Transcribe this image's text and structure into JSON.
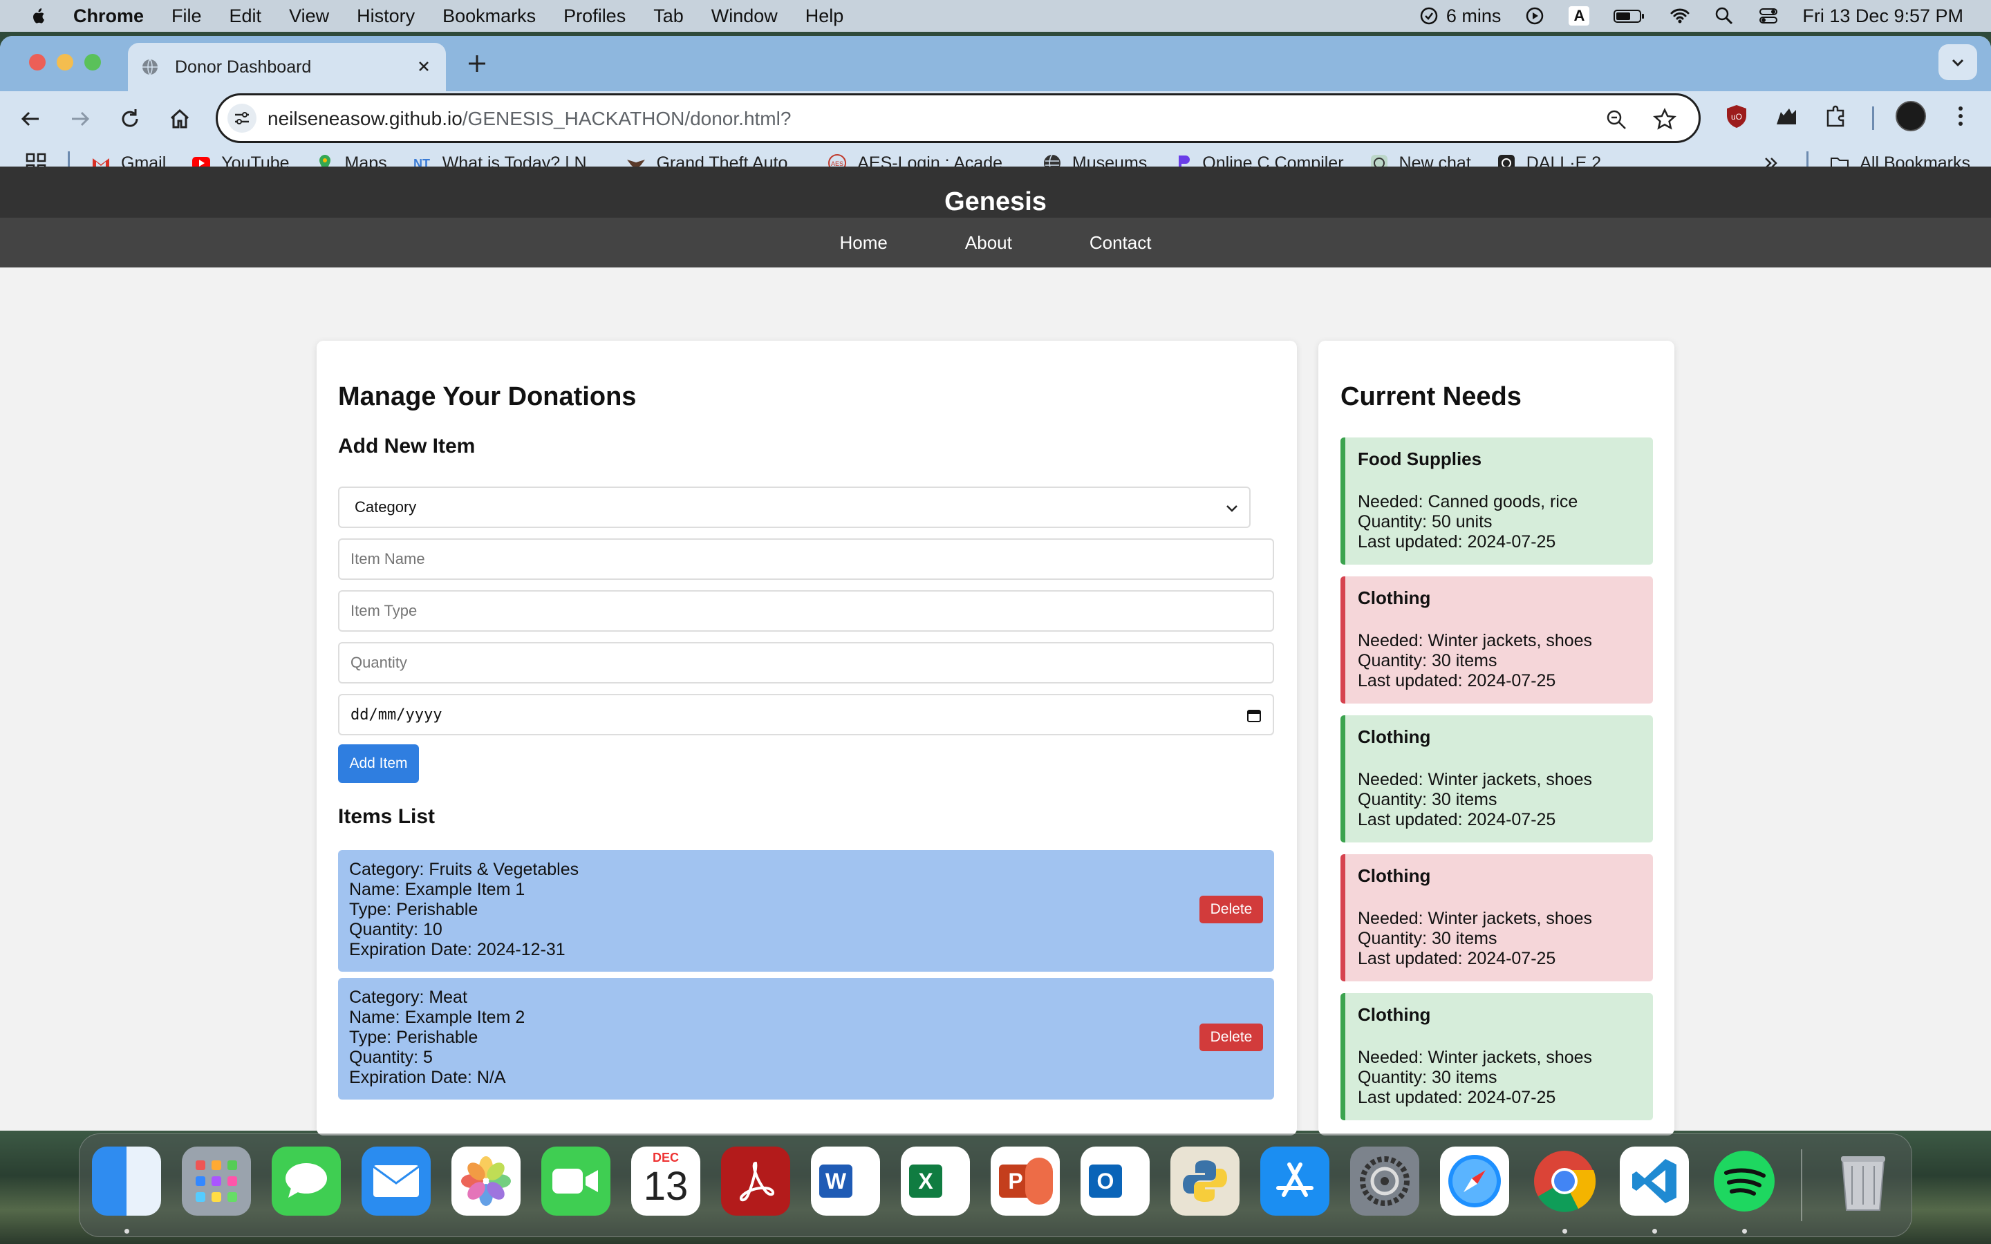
{
  "menubar": {
    "app": "Chrome",
    "menus": [
      "File",
      "Edit",
      "View",
      "History",
      "Bookmarks",
      "Profiles",
      "Tab",
      "Window",
      "Help"
    ],
    "timer": "6 mins",
    "input_indicator": "A",
    "datetime": "Fri 13 Dec  9:57 PM"
  },
  "browser": {
    "tab_title": "Donor Dashboard",
    "url_host": "neilseneasow.github.io",
    "url_path": "/GENESIS_HACKATHON/donor.html?",
    "bookmarks": [
      "Gmail",
      "YouTube",
      "Maps",
      "What is Today? | N...",
      "Grand Theft Auto...",
      "AES-Login : Acade...",
      "Museums",
      "Online C Compiler",
      "New chat",
      "DALL·E 2"
    ],
    "all_bookmarks": "All Bookmarks"
  },
  "site": {
    "title": "Genesis",
    "nav": [
      "Home",
      "About",
      "Contact"
    ]
  },
  "donations": {
    "heading": "Manage Your Donations",
    "add_heading": "Add New Item",
    "category_select": "Category",
    "item_name_placeholder": "Item Name",
    "item_type_placeholder": "Item Type",
    "quantity_placeholder": "Quantity",
    "date_placeholder": "dd/mm/yyyy",
    "add_button": "Add Item",
    "list_heading": "Items List",
    "items": [
      {
        "category": "Category: Fruits & Vegetables",
        "name": "Name: Example Item 1",
        "type": "Type: Perishable",
        "quantity": "Quantity: 10",
        "expiration": "Expiration Date: 2024-12-31",
        "delete": "Delete"
      },
      {
        "category": "Category: Meat",
        "name": "Name: Example Item 2",
        "type": "Type: Perishable",
        "quantity": "Quantity: 5",
        "expiration": "Expiration Date: N/A",
        "delete": "Delete"
      }
    ]
  },
  "needs": {
    "heading": "Current Needs",
    "items": [
      {
        "title": "Food Supplies",
        "needed": "Needed: Canned goods, rice",
        "quantity": "Quantity: 50 units",
        "updated": "Last updated: 2024-07-25",
        "status_color": "#3ca34f"
      },
      {
        "title": "Clothing",
        "needed": "Needed: Winter jackets, shoes",
        "quantity": "Quantity: 30 items",
        "updated": "Last updated: 2024-07-25",
        "status_color": "#d6434f"
      },
      {
        "title": "Clothing",
        "needed": "Needed: Winter jackets, shoes",
        "quantity": "Quantity: 30 items",
        "updated": "Last updated: 2024-07-25",
        "status_color": "#3ca34f"
      },
      {
        "title": "Clothing",
        "needed": "Needed: Winter jackets, shoes",
        "quantity": "Quantity: 30 items",
        "updated": "Last updated: 2024-07-25",
        "status_color": "#d6434f"
      },
      {
        "title": "Clothing",
        "needed": "Needed: Winter jackets, shoes",
        "quantity": "Quantity: 30 items",
        "updated": "Last updated: 2024-07-25",
        "status_color": "#3ca34f"
      }
    ]
  },
  "dock": {
    "calendar_month": "DEC",
    "calendar_day": "13",
    "apps": [
      "finder-icon",
      "launchpad-icon",
      "messages-icon",
      "mail-icon",
      "photos-icon",
      "facetime-icon",
      "calendar-icon",
      "acrobat-icon",
      "word-icon",
      "excel-icon",
      "powerpoint-icon",
      "outlook-icon",
      "python-icon",
      "app-store-icon",
      "system-settings-icon",
      "safari-icon",
      "chrome-icon",
      "vscode-icon",
      "spotify-icon",
      "trash-icon"
    ]
  }
}
